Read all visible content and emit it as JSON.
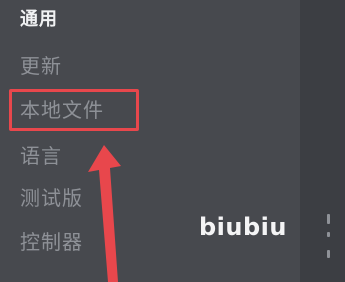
{
  "sidebar": {
    "items": [
      {
        "label": "通用",
        "active": true
      },
      {
        "label": "更新",
        "active": false
      },
      {
        "label": "本地文件",
        "active": false,
        "highlighted": true
      },
      {
        "label": "语言",
        "active": false
      },
      {
        "label": "测试版",
        "active": false
      },
      {
        "label": "控制器",
        "active": false
      }
    ]
  },
  "watermark": {
    "text": "biubiu"
  },
  "colors": {
    "highlight": "#e8474c",
    "active_text": "#f1f2f3",
    "inactive_text": "#8e9197",
    "sidebar_bg": "#47494e"
  },
  "annotation": {
    "arrow_icon": "red-arrow-up-icon"
  }
}
